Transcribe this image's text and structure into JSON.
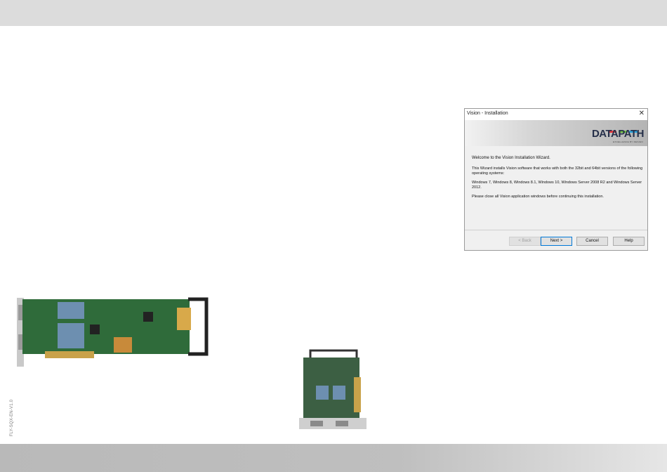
{
  "document": {
    "code": "FLY-SQX-EN-V1.0"
  },
  "dialog": {
    "title": "Vision - Installation",
    "brand": {
      "name": "DATAPATH",
      "tagline": "EXCELLENCE BY DESIGN"
    },
    "colors": {
      "stripe_red": "#e8383d",
      "stripe_green": "#6cbf3f",
      "stripe_blue": "#2aa3dc"
    },
    "welcome": "Welcome to the Vision Installation Wizard.",
    "para1": "This Wizard installs Vision software that works with both the 32bit and 64bit versions of the following operating systems:",
    "para2": "Windows 7, Windows 8, Windows 8.1, Windows 10, Windows Server 2008 R2 and Windows Server 2012.",
    "para3": "Please close all Vision application windows before continuing this installation.",
    "buttons": {
      "back": "< Back",
      "next": "Next >",
      "cancel": "Cancel",
      "help": "Help"
    }
  }
}
